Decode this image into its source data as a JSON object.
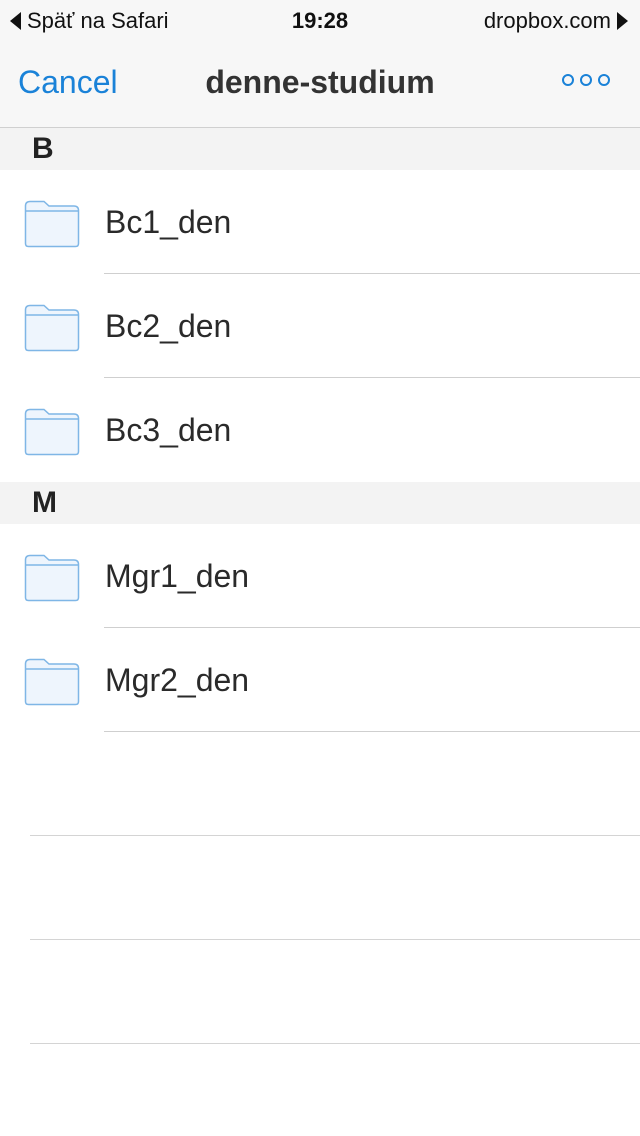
{
  "status_bar": {
    "back_label": "Späť na Safari",
    "time": "19:28",
    "site": "dropbox.com"
  },
  "nav": {
    "cancel_label": "Cancel",
    "title": "denne-studium",
    "more_icon": "more-dots-icon"
  },
  "sections": [
    {
      "header": "B",
      "items": [
        {
          "name": "Bc1_den",
          "icon": "folder-icon"
        },
        {
          "name": "Bc2_den",
          "icon": "folder-icon"
        },
        {
          "name": "Bc3_den",
          "icon": "folder-icon"
        }
      ]
    },
    {
      "header": "M",
      "items": [
        {
          "name": "Mgr1_den",
          "icon": "folder-icon"
        },
        {
          "name": "Mgr2_den",
          "icon": "folder-icon"
        }
      ]
    }
  ],
  "colors": {
    "accent": "#1a82d8",
    "folder_stroke": "#7fb6e6",
    "folder_fill": "#eef5fd",
    "bar_background": "#f7f7f7"
  }
}
